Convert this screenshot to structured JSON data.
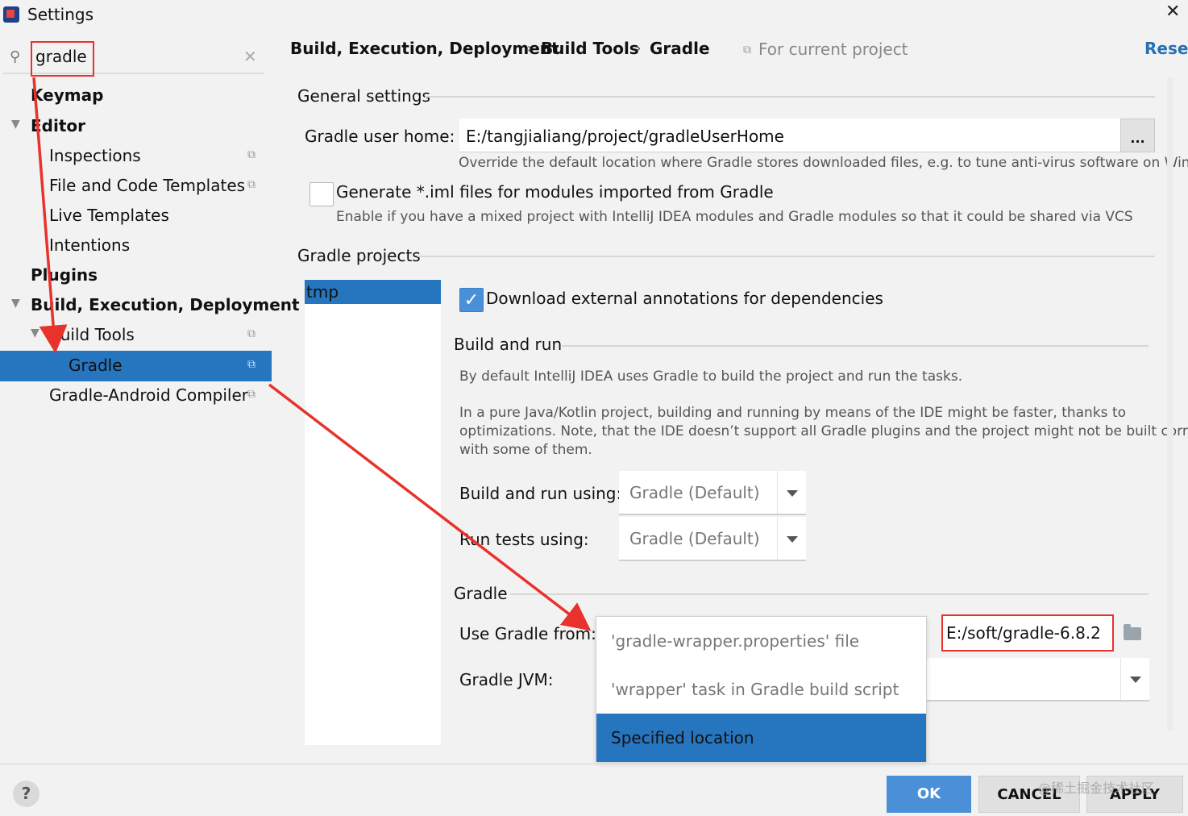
{
  "window": {
    "title": "Settings"
  },
  "search": {
    "value": "gradle"
  },
  "tree": {
    "keymap": "Keymap",
    "editor": "Editor",
    "inspections": "Inspections",
    "file_code_templates": "File and Code Templates",
    "live_templates": "Live Templates",
    "intentions": "Intentions",
    "plugins": "Plugins",
    "build_exec_deploy": "Build, Execution, Deployment",
    "build_tools": "Build Tools",
    "gradle": "Gradle",
    "gradle_android": "Gradle-Android Compiler"
  },
  "breadcrumb": {
    "items": [
      "Build, Execution, Deployment",
      "Build Tools",
      "Gradle"
    ],
    "sep": "›",
    "scope": "For current project",
    "reset": "Reset"
  },
  "general": {
    "title": "General settings",
    "user_home_label": "Gradle user home:",
    "user_home_value": "E:/tangjialiang/project/gradleUserHome",
    "browse_label": "...",
    "user_home_desc": "Override the default location where Gradle stores downloaded files, e.g. to tune anti-virus software on Windows",
    "iml_label": "Generate *.iml files for modules imported from Gradle",
    "iml_desc": "Enable if you have a mixed project with IntelliJ IDEA modules and Gradle modules so that it could be shared via VCS"
  },
  "projects": {
    "title": "Gradle projects",
    "items": [
      "tmp"
    ],
    "download_annotations": "Download external annotations for dependencies"
  },
  "build_run": {
    "title": "Build and run",
    "desc1": "By default IntelliJ IDEA uses Gradle to build the project and run the tasks.",
    "desc2_line1": "In a pure Java/Kotlin project, building and running by means of the IDE might be faster, thanks to",
    "desc2_line2": "optimizations. Note, that the IDE doesn’t support all Gradle plugins and the project might not be built correctly",
    "desc2_line3": "with some of them.",
    "using_label": "Build and run using:",
    "using_value": "Gradle (Default)",
    "tests_label": "Run tests using:",
    "tests_value": "Gradle (Default)"
  },
  "gradle_section": {
    "title": "Gradle",
    "use_from_label": "Use Gradle from:",
    "options": [
      "'gradle-wrapper.properties' file",
      "'wrapper' task in Gradle build script",
      "Specified location"
    ],
    "location_value": "E:/soft/gradle-6.8.2",
    "jvm_label": "Gradle JVM:"
  },
  "buttons": {
    "ok": "OK",
    "cancel": "CANCEL",
    "apply": "APPLY",
    "help": "?"
  },
  "watermark": "@稀土掘金技术社区",
  "colors": {
    "selection": "#2675bf",
    "annotation_red": "#e8322c",
    "ok_button": "#4a90d9"
  },
  "icons": [
    "search-icon",
    "clear-icon",
    "close-icon",
    "copy-icon",
    "folder-icon",
    "chevron-down-icon",
    "checkmark-icon",
    "help-icon"
  ]
}
